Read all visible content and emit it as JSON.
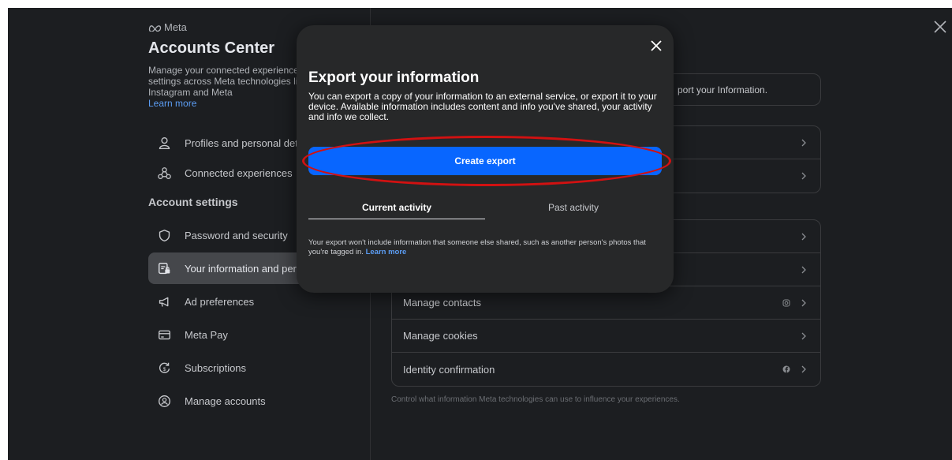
{
  "brand": {
    "name": "Meta",
    "icon": "meta-logo-icon"
  },
  "accounts_center": {
    "title": "Accounts Center",
    "description": "Manage your connected experiences and account settings across Meta technologies like Facebook, Instagram and Meta",
    "learn_more": "Learn more"
  },
  "sidebar": {
    "top_items": [
      {
        "label": "Profiles and personal details",
        "icon": "person-icon"
      },
      {
        "label": "Connected experiences",
        "icon": "connected-icon"
      }
    ],
    "section_label": "Account settings",
    "items": [
      {
        "label": "Password and security",
        "icon": "shield-icon"
      },
      {
        "label": "Your information and permissions",
        "icon": "id-card-icon",
        "active": true
      },
      {
        "label": "Ad preferences",
        "icon": "megaphone-icon"
      },
      {
        "label": "Meta Pay",
        "icon": "card-icon"
      },
      {
        "label": "Subscriptions",
        "icon": "subscription-icon"
      },
      {
        "label": "Manage accounts",
        "icon": "account-circle-icon"
      }
    ]
  },
  "content": {
    "info_text": "port your Information.",
    "rows": [
      {
        "label": "Manage contacts",
        "badge": "instagram-icon"
      },
      {
        "label": "Manage cookies",
        "badge": ""
      },
      {
        "label": "Identity confirmation",
        "badge": "facebook-icon"
      }
    ],
    "footnote": "Control what information Meta technologies can use to influence your experiences."
  },
  "modal": {
    "title": "Export your information",
    "body": "You can export a copy of your information to an external service, or export it to your device. Available information includes content and info you've shared, your activity and info we collect.",
    "primary_button": "Create export",
    "tabs": [
      {
        "label": "Current activity",
        "selected": true
      },
      {
        "label": "Past activity",
        "selected": false
      }
    ],
    "note": "Your export won't include information that someone else shared, such as another person's photos that you're tagged in.",
    "note_link": "Learn more"
  },
  "colors": {
    "accent": "#0866ff",
    "highlight": "#d21111",
    "background": "#1c1e21",
    "modal_background": "#272829"
  }
}
